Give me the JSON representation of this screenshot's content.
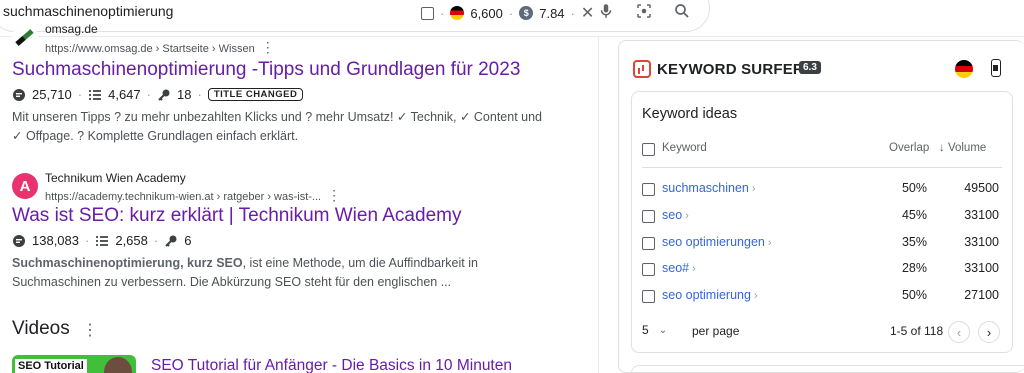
{
  "search": {
    "query": "suchmaschinenoptimierung",
    "volume": "6,600",
    "cpc": "7.84"
  },
  "results": [
    {
      "site_name": "omsag.de",
      "url": "https://www.omsag.de › Startseite › Wissen",
      "title": "Suchmaschinenoptimierung -Tipps und Grundlagen für 2023",
      "words": "25,710",
      "headings": "4,647",
      "keys": "18",
      "badge": "TITLE CHANGED",
      "snippet": "Mit unseren Tipps ? zu mehr unbezahlten Klicks und ? mehr Umsatz! ✓ Technik, ✓ Content und ✓ Offpage. ? Komplette Grundlagen einfach erklärt."
    },
    {
      "site_name": "Technikum Wien Academy",
      "url": "https://academy.technikum-wien.at › ratgeber › was-ist-...",
      "title": "Was ist SEO: kurz erklärt | Technikum Wien Academy",
      "words": "138,083",
      "headings": "2,658",
      "keys": "6",
      "snippet_bold": "Suchmaschinenoptimierung, kurz SEO",
      "snippet_rest": ", ist eine Methode, um die Auffindbarkeit in Suchmaschinen zu verbessern. Die Abkürzung SEO steht für den englischen ..."
    }
  ],
  "videos": {
    "heading": "Videos",
    "thumb_text": "SEO Tutorial",
    "first_title": "SEO Tutorial für Anfänger - Die Basics in 10 Minuten"
  },
  "surfer": {
    "brand": "KEYWORD SURFER",
    "version": "6.3",
    "panel_title": "Keyword ideas",
    "col_keyword": "Keyword",
    "col_overlap": "Overlap",
    "col_volume": "↓ Volume",
    "rows": [
      {
        "keyword": "suchmaschinen",
        "overlap": "50%",
        "volume": "49500"
      },
      {
        "keyword": "seo",
        "overlap": "45%",
        "volume": "33100"
      },
      {
        "keyword": "seo optimierungen",
        "overlap": "35%",
        "volume": "33100"
      },
      {
        "keyword": "seo#",
        "overlap": "28%",
        "volume": "33100"
      },
      {
        "keyword": "seo optimierung",
        "overlap": "50%",
        "volume": "27100"
      }
    ],
    "per_page_value": "5",
    "per_page_label": "per page",
    "range": "1-5 of 118"
  },
  "colors": {
    "visited_link": "#681da8",
    "keyword_link": "#3367d6",
    "brand_red": "#e0433a"
  }
}
